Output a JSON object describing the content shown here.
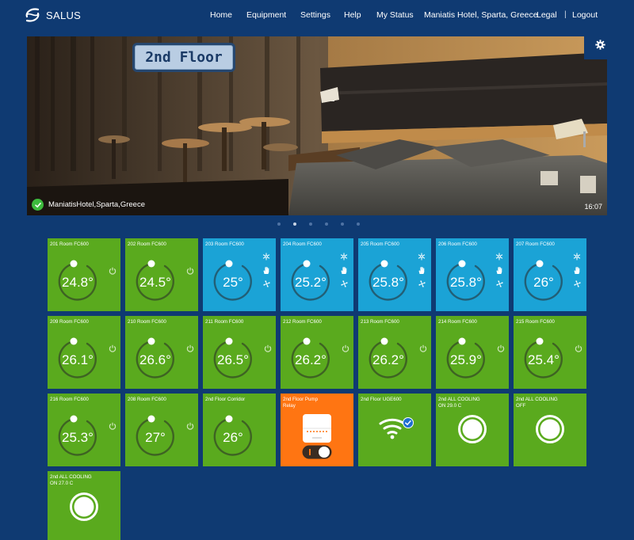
{
  "app": {
    "brand": "SALUS"
  },
  "nav": {
    "home": "Home",
    "equipment": "Equipment",
    "settings": "Settings",
    "help": "Help",
    "status": "My Status",
    "site": "Maniatis Hotel, Sparta, Greece",
    "legal": "Legal",
    "separator": "|",
    "logout": "Logout"
  },
  "hero": {
    "floor_label": "2nd Floor",
    "location": "ManiatisHotel,Sparta,Greece",
    "time": "16:07",
    "slide_count": 6,
    "active_slide": 1
  },
  "colors": {
    "background": "#0f3a72",
    "heating": "#5aaa1e",
    "cooling": "#1ba3d6",
    "relay": "#ff7512"
  },
  "tiles": [
    {
      "title": "201 Room FC600",
      "temp": "24.8°",
      "mode": "heat"
    },
    {
      "title": "202 Room FC600",
      "temp": "24.5°",
      "mode": "heat"
    },
    {
      "title": "203 Room FC600",
      "temp": "25°",
      "mode": "cool"
    },
    {
      "title": "204 Room FC600",
      "temp": "25.2°",
      "mode": "cool"
    },
    {
      "title": "205 Room FC600",
      "temp": "25.8°",
      "mode": "cool"
    },
    {
      "title": "206 Room FC600",
      "temp": "25.8°",
      "mode": "cool"
    },
    {
      "title": "207 Room FC600",
      "temp": "26°",
      "mode": "cool"
    },
    {
      "title": "209 Room FC600",
      "temp": "26.1°",
      "mode": "heat"
    },
    {
      "title": "210 Room FC600",
      "temp": "26.6°",
      "mode": "heat"
    },
    {
      "title": "211 Room FC600",
      "temp": "26.5°",
      "mode": "heat"
    },
    {
      "title": "212 Room FC600",
      "temp": "26.2°",
      "mode": "heat"
    },
    {
      "title": "213 Room FC600",
      "temp": "26.2°",
      "mode": "heat"
    },
    {
      "title": "214 Room FC600",
      "temp": "25.9°",
      "mode": "heat"
    },
    {
      "title": "215 Room FC600",
      "temp": "25.4°",
      "mode": "heat"
    },
    {
      "title": "216 Room FC600",
      "temp": "25.3°",
      "mode": "heat"
    },
    {
      "title": "208 Room FC600",
      "temp": "27°",
      "mode": "heat"
    },
    {
      "title": "2nd Floor Corridor",
      "temp": "26°",
      "mode": "plain"
    },
    {
      "title": "2nd Floor Pump\nRelay",
      "temp": "",
      "mode": "relay"
    },
    {
      "title": "2nd Floor UGE600",
      "temp": "",
      "mode": "gateway"
    },
    {
      "title": "2nd ALL COOLING\nON 29.0 C",
      "temp": "",
      "mode": "ring"
    },
    {
      "title": "2nd ALL COOLING\nOFF",
      "temp": "",
      "mode": "ring"
    },
    {
      "title": "2nd ALL COOLING\nON 27.0 C",
      "temp": "",
      "mode": "ring"
    }
  ],
  "icons": {
    "logo": "salus-logo-icon",
    "settings": "gear-icon",
    "location_status": "check-circle-icon",
    "power": "power-icon",
    "cool": "snowflake-icon",
    "manual": "hand-icon",
    "fan": "fan-icon",
    "wifi": "wifi-icon"
  }
}
